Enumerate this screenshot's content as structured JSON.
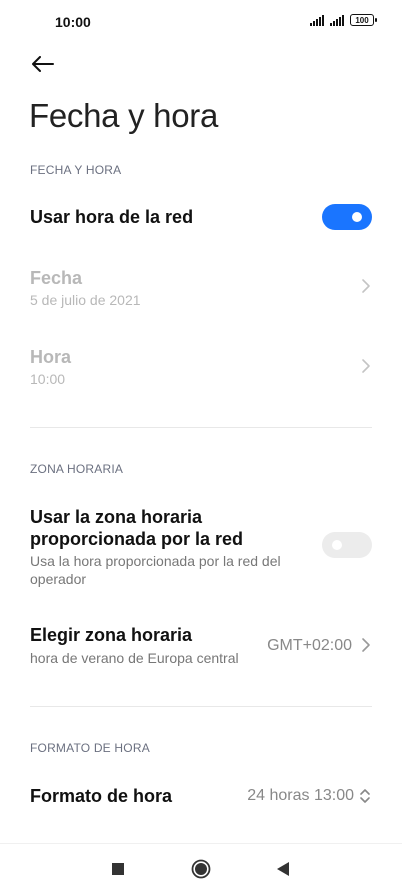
{
  "status_bar": {
    "time": "10:00",
    "battery": "100"
  },
  "header": {
    "title": "Fecha y hora"
  },
  "sections": {
    "date_time": {
      "header": "FECHA Y HORA",
      "network_time": {
        "label": "Usar hora de la red",
        "enabled": true
      },
      "date": {
        "label": "Fecha",
        "value": "5 de julio de 2021"
      },
      "time": {
        "label": "Hora",
        "value": "10:00"
      }
    },
    "time_zone": {
      "header": "ZONA HORARIA",
      "network_zone": {
        "label_line1": "Usar la zona horaria",
        "label_line2": "proporcionada por la red",
        "desc_line1": "Usa la hora proporcionada por la red del",
        "desc_line2": "operador",
        "enabled": false
      },
      "choose_zone": {
        "label": "Elegir zona horaria",
        "desc": "hora de verano de Europa central",
        "value": "GMT+02:00"
      }
    },
    "time_format": {
      "header": "FORMATO DE HORA",
      "format": {
        "label": "Formato de hora",
        "value": "24 horas 13:00"
      }
    }
  },
  "icons": {
    "back": "arrow-left-icon",
    "chevron": "chevron-right-icon",
    "updown": "chevron-up-down-icon",
    "nav_recent": "square-icon",
    "nav_home": "circle-icon",
    "nav_back": "triangle-left-icon"
  },
  "colors": {
    "accent": "#1a75ff",
    "section_header": "#6b7080",
    "disabled_text": "#b8b8b8"
  }
}
